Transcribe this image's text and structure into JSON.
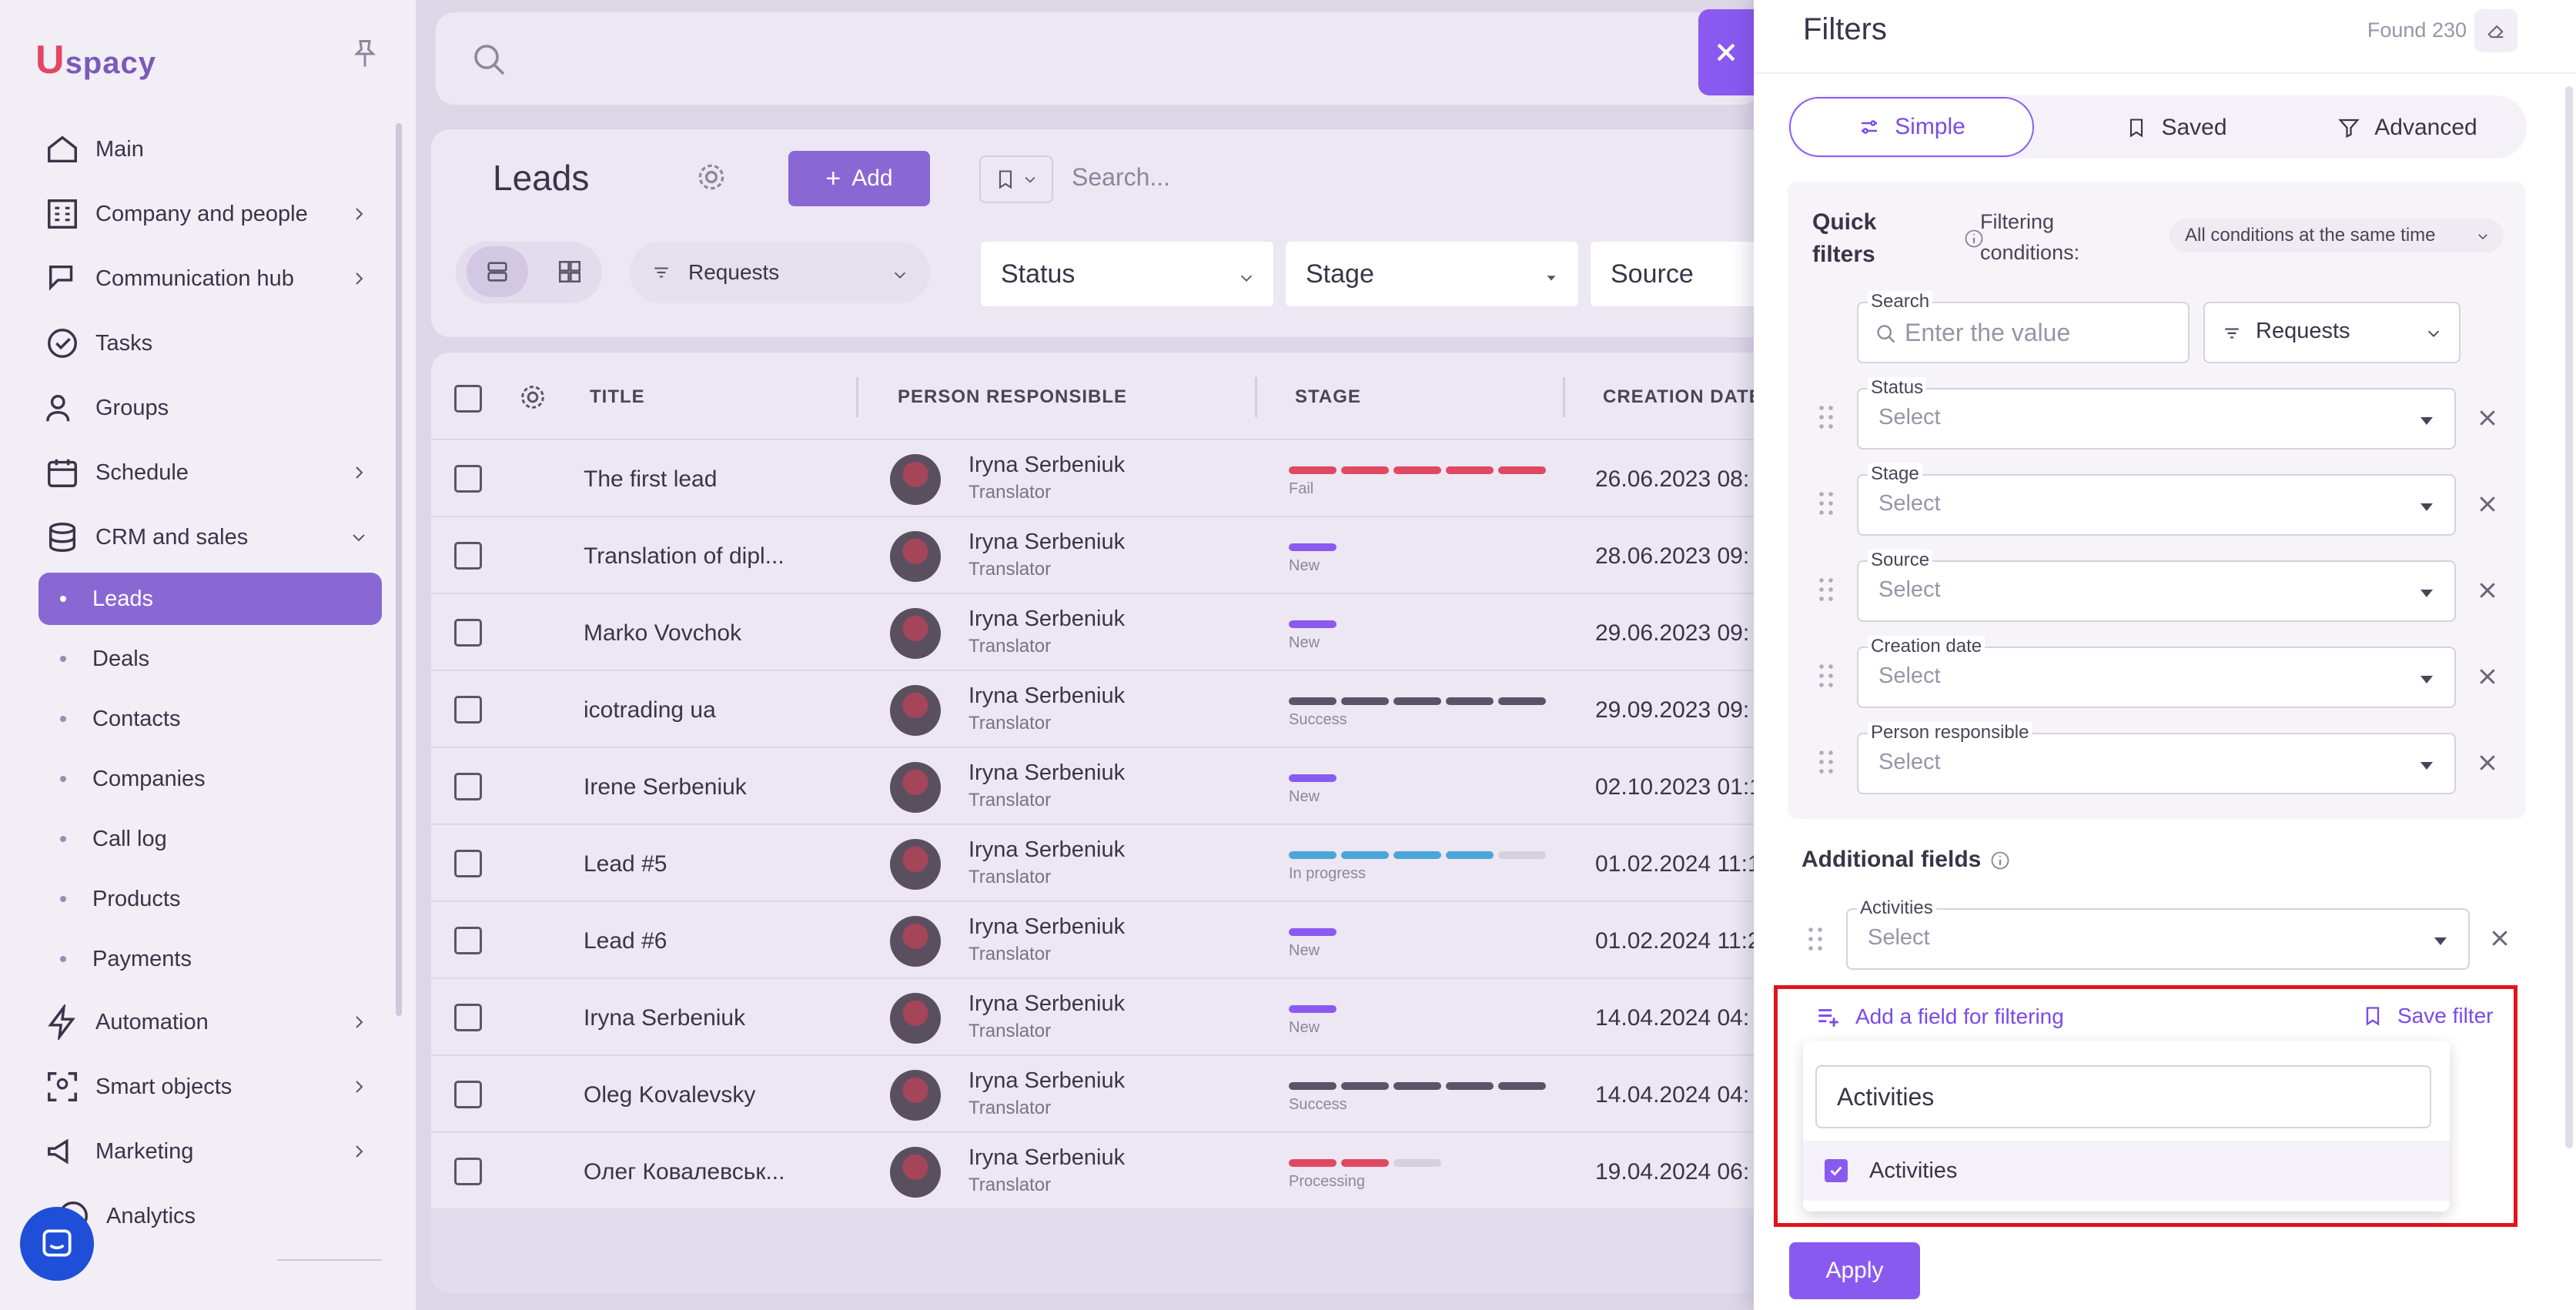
{
  "colors": {
    "accent": "#8a5af0",
    "highlight": "#e2141c",
    "sidebar_active": "#8a68d4"
  },
  "sidebar": {
    "logo_u": "U",
    "logo_text": "spacy",
    "items": [
      {
        "label": "Main",
        "icon": "home-icon"
      },
      {
        "label": "Company and people",
        "icon": "building-icon"
      },
      {
        "label": "Communication hub",
        "icon": "chat-edit-icon"
      },
      {
        "label": "Tasks",
        "icon": "check-circle-icon"
      },
      {
        "label": "Groups",
        "icon": "people-icon"
      },
      {
        "label": "Schedule",
        "icon": "calendar-icon"
      },
      {
        "label": "CRM and sales",
        "icon": "database-icon"
      },
      {
        "label": "Automation",
        "icon": "lightning-icon"
      },
      {
        "label": "Smart objects",
        "icon": "scan-icon"
      },
      {
        "label": "Marketing",
        "icon": "megaphone-icon"
      },
      {
        "label": "Analytics",
        "icon": "chart-icon"
      }
    ],
    "crm_sub": [
      "Leads",
      "Deals",
      "Contacts",
      "Companies",
      "Call log",
      "Products",
      "Payments"
    ]
  },
  "leads": {
    "title": "Leads",
    "add_label": "Add",
    "search_placeholder": "Search...",
    "requests_label": "Requests",
    "filters": [
      "Status",
      "Stage",
      "Source"
    ]
  },
  "table": {
    "columns": [
      "TITLE",
      "PERSON RESPONSIBLE",
      "STAGE",
      "CREATION DATE"
    ],
    "rows": [
      {
        "title": "The first lead",
        "person": "Iryna Serbeniuk",
        "role": "Translator",
        "stage": "Fail",
        "date": "26.06.2023 08:"
      },
      {
        "title": "Translation of dipl...",
        "person": "Iryna Serbeniuk",
        "role": "Translator",
        "stage": "New",
        "date": "28.06.2023 09:"
      },
      {
        "title": "Marko Vovchok",
        "person": "Iryna Serbeniuk",
        "role": "Translator",
        "stage": "New",
        "date": "29.06.2023 09:"
      },
      {
        "title": "icotrading ua",
        "person": "Iryna Serbeniuk",
        "role": "Translator",
        "stage": "Success",
        "date": "29.09.2023 09:"
      },
      {
        "title": "Irene Serbeniuk",
        "person": "Iryna Serbeniuk",
        "role": "Translator",
        "stage": "New",
        "date": "02.10.2023 01:1"
      },
      {
        "title": "Lead #5",
        "person": "Iryna Serbeniuk",
        "role": "Translator",
        "stage": "In progress",
        "date": "01.02.2024 11:1"
      },
      {
        "title": "Lead #6",
        "person": "Iryna Serbeniuk",
        "role": "Translator",
        "stage": "New",
        "date": "01.02.2024 11:2"
      },
      {
        "title": "Iryna Serbeniuk",
        "person": "Iryna Serbeniuk",
        "role": "Translator",
        "stage": "New",
        "date": "14.04.2024 04:"
      },
      {
        "title": "Oleg Kovalevsky",
        "person": "Iryna Serbeniuk",
        "role": "Translator",
        "stage": "Success",
        "date": "14.04.2024 04:"
      },
      {
        "title": "Олег Ковалевськ...",
        "person": "Iryna Serbeniuk",
        "role": "Translator",
        "stage": "Processing",
        "date": "19.04.2024 06:"
      }
    ]
  },
  "drawer": {
    "title": "Filters",
    "found": "Found 230",
    "tabs": [
      "Simple",
      "Saved",
      "Advanced"
    ],
    "quick_filters_line1": "Quick",
    "quick_filters_line2": "filters",
    "filtering_line1": "Filtering",
    "filtering_line2": "conditions:",
    "conditions_value": "All conditions at the same time",
    "search_label": "Search",
    "search_placeholder": "Enter the value",
    "requests_value": "Requests",
    "fields": [
      {
        "label": "Status",
        "value": "Select"
      },
      {
        "label": "Stage",
        "value": "Select"
      },
      {
        "label": "Source",
        "value": "Select"
      },
      {
        "label": "Creation date",
        "value": "Select"
      },
      {
        "label": "Person responsible",
        "value": "Select"
      }
    ],
    "additional_title": "Additional fields",
    "additional_field": {
      "label": "Activities",
      "value": "Select"
    },
    "add_field_label": "Add a field for filtering",
    "save_filter_label": "Save filter",
    "dropdown_search": "Activities",
    "dropdown_option": "Activities",
    "apply_label": "Apply"
  }
}
